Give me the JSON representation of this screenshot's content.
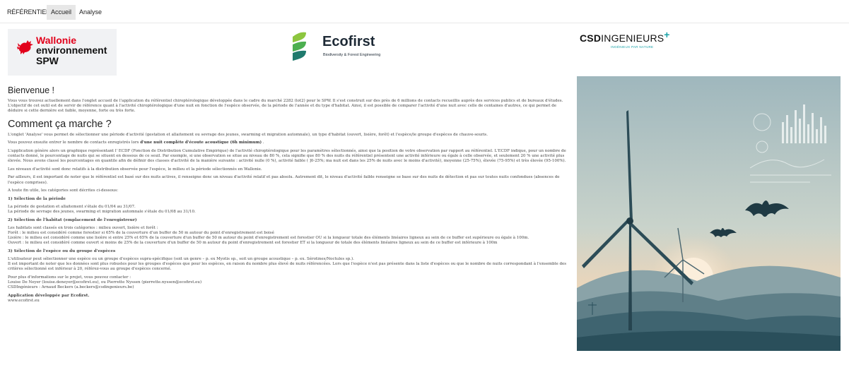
{
  "nav": {
    "brand": "RÉFÉRENTIEL",
    "tabs": [
      {
        "label": "Accueil",
        "active": true
      },
      {
        "label": "Analyse",
        "active": false
      }
    ]
  },
  "logos": {
    "wallonie": {
      "line1": "Wallonie",
      "line2": "environnement",
      "line3": "SPW",
      "icon": "rooster-icon"
    },
    "ecofirst": {
      "name": "Ecofirst",
      "tagline": "Biodiversity & Forest Engineering",
      "icon": "ecofirst-leaf-icon"
    },
    "csd": {
      "name_bold": "CSD",
      "name_rest": "INGENIEURS",
      "plus": "+",
      "tagline": "INGÉNIEUX PAR NATURE"
    }
  },
  "welcome": {
    "title": "Bienvenue !",
    "text": "Vous vous trouvez actuellement dans l'onglet accueil de l'application du référentiel chiroptérologique développée dans le cadre du marché 2282 (lot2) pour le SPW. Il s'est construit sur des près de 6 millions de contacts recueillis auprès des services publics et de bureaux d'études. L'objectif de cet outil est de servir de référence quant à l'activité chiroptérologique d'une nuit en fonction de l'espèce observée, de la période de l'année et du type d'habitat. Ainsi, il est possible de comparer l'activité d'une nuit avec celle de centaines d'autres, ce qui permet de déduire si cette dernière est faible, moyenne, forte ou très forte."
  },
  "how": {
    "title": "Comment ça marche ?",
    "p1": "L'onglet 'Analyse' vous permet de sélectionner une période d'activité (gestation et allaitement ou sevrage des jeunes, swarming et migration automnale), un type d'habitat (ouvert, lisière, forêt) et l'espèce/le groupe d'espèces de chauve-souris.",
    "p2_start": "Vous pouvez ensuite entrer le nombre de contacts enregistrés lors ",
    "p2_bold": "d'une nuit complète d'écoute acoustique (6h minimum)",
    "p2_end": " .",
    "p3": "L'application génère alors un graphique représentant l' ECDF (Fonction de Distribution Cumulative Empirique) de l'activité chiroptérologique pour les paramètres sélectionnés, ainsi que la position de votre observation par rapport au référentiel. L'ECDF indique, pour un nombre de contacts donné, le pourcentage de nuits qui se situent en dessous de ce seuil. Par exemple, si une observation se situe au niveau de 80 %, cela signifie que 80 % des nuits du référentiel présentent une activité inférieure ou égale à celle observée, et seulement 20 % une activité plus élevée. Nous avons classé les pourcentages en quantile afin de définir des classes d'activité de la manière suivante : activité nulle (0 %), activité faible ( ]0-25%; ma nuit est dans les 25% de nuits avec le moins d'activité), moyenne (25-75%), élevée (75-95%) et très élevée (95-100%).",
    "p4": "Les niveaux d'activité sont donc relatifs à la distribution observée pour l'espèce, le milieu et la période sélectionnés en Wallonie.",
    "p5": "Par ailleurs, il est important de noter que le référentiel est basé sur des nuits actives, il renseigne donc un niveau d'activité relatif et pas absolu. Autrement dit, le niveau d'activité faible renseigne se base sur des nuits de détection et pas sur toutes nuits confondues (absences de l'espèce comprises).",
    "p6": "A toute fin utile, les catégories sont décrites ci-dessous:"
  },
  "sections": {
    "s1_title": "1) Sélection de la période",
    "s1_line1": "La période de gestation et allaitement s'étale du 01/04 au 31/07.",
    "s1_line2": "La période de sevrage des jeunes, swarming et migration automnale s'étale du 01/08 au 31/10.",
    "s2_title": "2) Sélection de l'habitat (emplacement de l'enregistreur)",
    "s2_line1": "Les habitats sont classés en trois catégories : milieu ouvert, lisière et forêt :",
    "s2_line2": "Forêt : le milieu est considéré comme forestier si 65% de la couverture d'un buffer de 50 m autour du point d'enregistrement est boisé",
    "s2_line3": "Lisière : le milieu est considéré comme une lisière si entre 25% et 65% de la couverture d'un buffer de 50 m autour du point d'enregistrement est forestier OU si la longueur totale des éléments linéaires ligneux au sein de ce buffer est supérieure ou égale à 100m.",
    "s2_line4": "Ouvert : le milieu est considéré comme ouvert si moins de 25% de la couverture d'un buffer de 50 m autour du point d'enregistrement est forestier ET si la longueur de totale des éléments linéaires ligneux au sein de ce buffer est inférieure à 100m",
    "s3_title": "3) Sélection de l'espèce ou du groupe d'espèces",
    "s3_line1": "L'utilisateur peut sélectionner une espèce ou un groupe d'espèces supra-spécifique (soit un genre – p. ex Myotis sp., soit un groupe acoustique – p. ex. Sérotines/Noctules sp.).",
    "s3_line2": "Il est important de noter que les données sont plus robustes pour les groupes d'espèces que pour les espèces, en raison du nombre plus élevé de nuits référencées. Lors que l'espèce n'est pas présente dans la liste d'espèces ou que le nombre de nuits correspondant à l'ensemble des critères sélectionné est inférieur à 20, référez-vous au groupe d'espèces concerné."
  },
  "contact": {
    "line1": "Pour plus d'informations sur le projet, vous pouvez contacter :",
    "line2": "Louise De Neyer (louise.deneyer@ecofirst.eu), ou Pierrette Nyssen (pierrette.nyssen@ecofirst.eu)",
    "line3": "CSDIngénieurs : Arnaud Beckers (a.beckers@csdingenieurs.be)",
    "credit": "Application développée par Ecofirst.",
    "website": "www.ecofirst.eu"
  },
  "colors": {
    "wallonie_red": "#e2001a",
    "ecofirst_green": "#8dc63f",
    "ecofirst_dark": "#1e2a36",
    "csd_teal": "#1aa2a8"
  }
}
